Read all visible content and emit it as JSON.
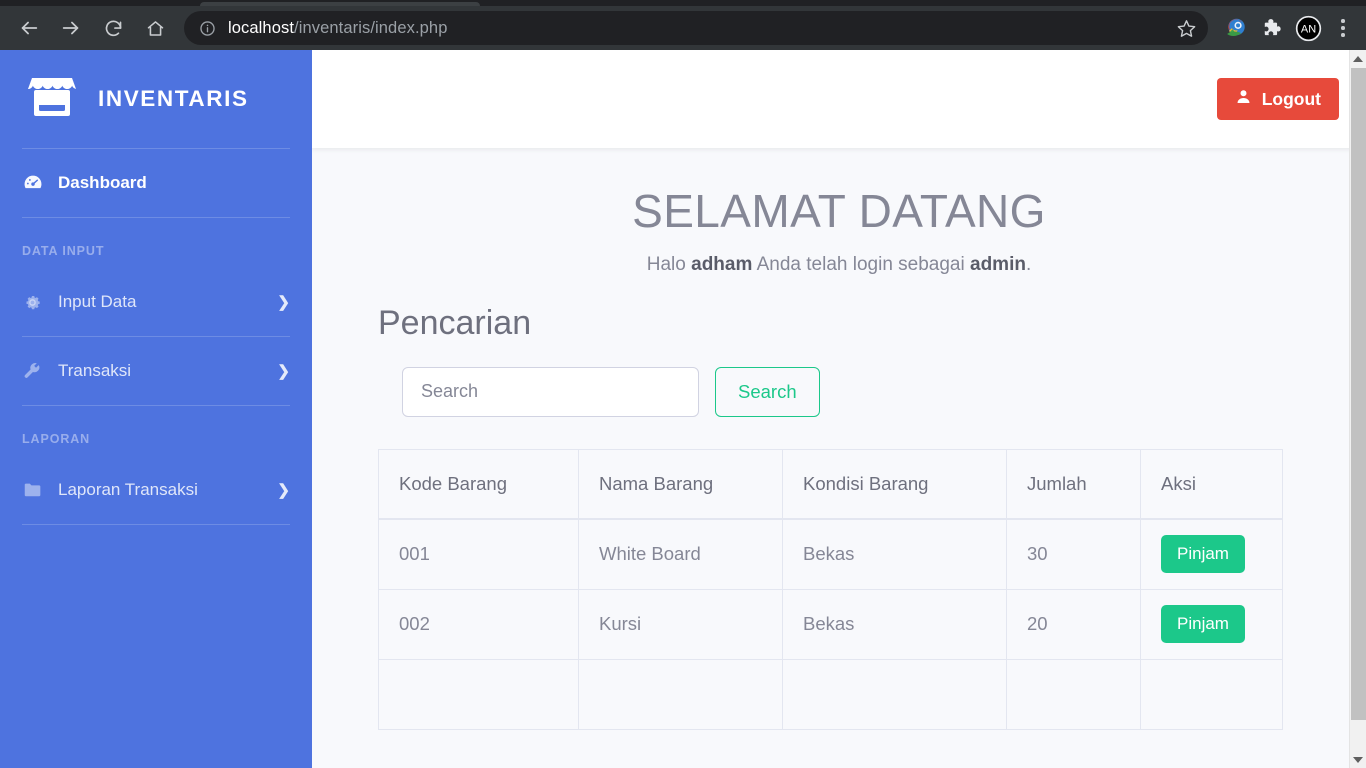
{
  "browser": {
    "url_host": "localhost",
    "url_path": "/inventaris/index.php",
    "back_icon": "back-arrow-icon",
    "forward_icon": "forward-arrow-icon",
    "reload_icon": "reload-icon",
    "home_icon": "home-icon",
    "site_info_icon": "info-circle-icon",
    "bookmark_icon": "star-icon",
    "extension_icons": [
      "colorful-globe-extension-icon",
      "puzzle-piece-extensions-icon",
      "account-avatar-icon"
    ],
    "menu_icon": "three-dot-menu-icon",
    "avatar_initials": "AN"
  },
  "sidebar": {
    "brand": "INVENTARIS",
    "brand_icon": "store-icon",
    "accent_color": "#4e73df",
    "items": [
      {
        "label": "Dashboard",
        "icon": "tachometer-icon",
        "active": true,
        "caret": ""
      },
      {
        "label": "Input Data",
        "icon": "gear-icon",
        "active": false,
        "caret": "❯"
      },
      {
        "label": "Transaksi",
        "icon": "wrench-icon",
        "active": false,
        "caret": "❯"
      },
      {
        "label": "Laporan Transaksi",
        "icon": "folder-icon",
        "active": false,
        "caret": "❯"
      }
    ],
    "headings": {
      "data_input": "DATA INPUT",
      "laporan": "LAPORAN"
    }
  },
  "topbar": {
    "logout_label": "Logout",
    "logout_icon": "user-icon",
    "logout_color": "#e74a3b"
  },
  "main": {
    "welcome_heading": "SELAMAT DATANG",
    "welcome_prefix": "Halo ",
    "welcome_user": "adham",
    "welcome_middle": " Anda telah login sebagai ",
    "welcome_role": "admin",
    "welcome_suffix": ".",
    "search_section_title": "Pencarian",
    "search_placeholder": "Search",
    "search_value": "",
    "search_button_label": "Search",
    "search_button_color": "#1cc88a"
  },
  "table": {
    "columns": [
      "Kode Barang",
      "Nama Barang",
      "Kondisi Barang",
      "Jumlah",
      "Aksi"
    ],
    "rows": [
      {
        "kode": "001",
        "nama": "White Board",
        "kondisi": "Bekas",
        "jumlah": "30",
        "aksi": "Pinjam"
      },
      {
        "kode": "002",
        "nama": "Kursi",
        "kondisi": "Bekas",
        "jumlah": "20",
        "aksi": "Pinjam"
      }
    ],
    "action_button_color": "#1cc88a"
  }
}
